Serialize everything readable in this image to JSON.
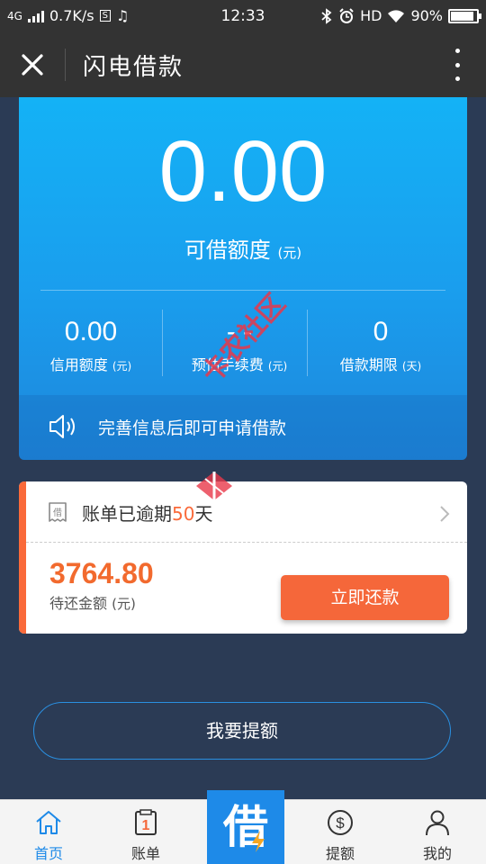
{
  "status_bar": {
    "network": "4G",
    "speed": "0.7K/s",
    "s_box": "S",
    "music_icon": "♫",
    "time": "12:33",
    "hd": "HD",
    "battery": "90%",
    "battery_level": 0.9
  },
  "header": {
    "title": "闪电借款"
  },
  "main": {
    "amount": "0.00",
    "limit_label": "可借额度",
    "limit_unit": "(元)",
    "stats": [
      {
        "value": "0.00",
        "label": "信用额度",
        "unit": "(元)"
      },
      {
        "value": "- -",
        "label": "预估手续费",
        "unit": "(元)"
      },
      {
        "value": "0",
        "label": "借款期限",
        "unit": "(天)"
      }
    ],
    "notice": "完善信息后即可申请借款"
  },
  "bill": {
    "receipt_char": "借",
    "overdue_prefix": "账单已逾期",
    "overdue_days": "50",
    "overdue_suffix": "天",
    "amount": "3764.80",
    "amount_label": "待还金额",
    "amount_unit": "(元)",
    "repay_button": "立即还款"
  },
  "raise_button": "我要提额",
  "watermark": "卡农社区",
  "tabs": {
    "home": "首页",
    "bill": "账单",
    "bill_badge": "1",
    "borrow": "借",
    "raise": "提额",
    "mine": "我的"
  },
  "colors": {
    "accent_blue": "#1e8ae8",
    "accent_orange": "#f5673a",
    "background": "#2b3b55",
    "header": "#333333"
  },
  "icons": [
    "close-icon",
    "more-icon",
    "speaker-icon",
    "receipt-icon",
    "chevron-right-icon",
    "home-icon",
    "bill-icon",
    "dollar-icon",
    "user-icon",
    "bolt-icon"
  ]
}
